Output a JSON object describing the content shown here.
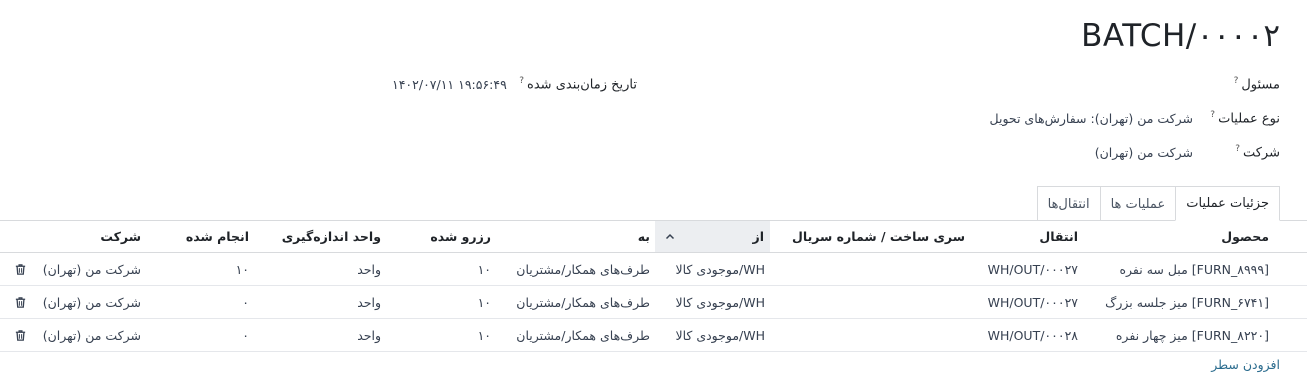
{
  "record": {
    "title": "BATCH/۰۰۰۰۲"
  },
  "fields": {
    "responsible": {
      "label": "مسئول",
      "help": "?"
    },
    "scheduled_date": {
      "label": "تاریخ زمان‌بندی شده",
      "help": "?",
      "value": "۱۴۰۲/۰۷/۱۱ ۱۹:۵۶:۴۹"
    },
    "operation_type": {
      "label": "نوع عملیات",
      "help": "?",
      "value": "شرکت من (تهران): سفارش‌های تحویل"
    },
    "company": {
      "label": "شرکت",
      "help": "?",
      "value": "شرکت من (تهران)"
    }
  },
  "tabs": [
    {
      "label": "جزئیات عملیات",
      "active": true
    },
    {
      "label": "عملیات ها",
      "active": false
    },
    {
      "label": "انتقال‌ها",
      "active": false
    }
  ],
  "table": {
    "columns": {
      "product": "محصول",
      "transfer": "انتقال",
      "lot": "سری ساخت / شماره سریال",
      "from": "از",
      "to": "به",
      "reserved": "رزرو شده",
      "uom": "واحد اندازه‌گیری",
      "done": "انجام شده",
      "company": "شرکت"
    },
    "rows": [
      {
        "product": "[FURN_۸۹۹۹] مبل سه نفره",
        "transfer": "WH/OUT/۰۰۰۲۷",
        "lot": "",
        "from": "WH/موجودی کالا",
        "to": "طرف‌های همکار/مشتریان",
        "reserved": "۱۰",
        "uom": "واحد",
        "done": "۱۰",
        "company": "شرکت من (تهران)"
      },
      {
        "product": "[FURN_۶۷۴۱] میز جلسه بزرگ",
        "transfer": "WH/OUT/۰۰۰۲۷",
        "lot": "",
        "from": "WH/موجودی کالا",
        "to": "طرف‌های همکار/مشتریان",
        "reserved": "۱۰",
        "uom": "واحد",
        "done": "۰",
        "company": "شرکت من (تهران)"
      },
      {
        "product": "[FURN_۸۲۲۰] میز چهار نفره",
        "transfer": "WH/OUT/۰۰۰۲۸",
        "lot": "",
        "from": "WH/موجودی کالا",
        "to": "طرف‌های همکار/مشتریان",
        "reserved": "۱۰",
        "uom": "واحد",
        "done": "۰",
        "company": "شرکت من (تهران)"
      }
    ]
  },
  "actions": {
    "add_line": "افزودن سطر"
  },
  "icons": {
    "delete": "trash-icon",
    "sort": "chevron-up-icon"
  }
}
